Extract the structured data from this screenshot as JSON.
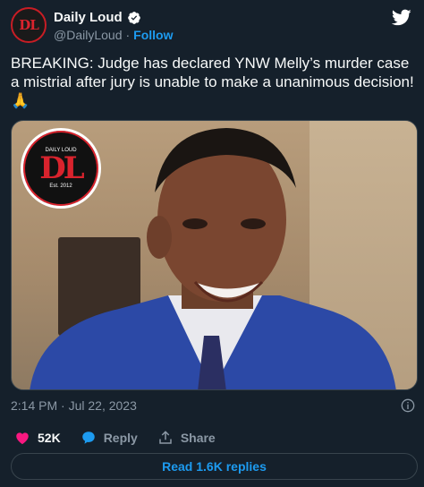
{
  "author": {
    "name": "Daily Loud",
    "handle": "@DailyLoud",
    "separator": "·",
    "follow_label": "Follow",
    "avatar_text": "DL"
  },
  "tweet": {
    "text": "BREAKING: Judge has declared YNW Melly’s murder case a mistrial after jury is unable to make a unanimous decision! 🙏",
    "timestamp": "2:14 PM · Jul 22, 2023"
  },
  "media": {
    "badge_text": "DL",
    "badge_caption": "DAILY LOUD",
    "badge_est": "Est. 2012"
  },
  "actions": {
    "likes": "52K",
    "reply_label": "Reply",
    "share_label": "Share"
  },
  "read_replies_label": "Read 1.6K replies",
  "colors": {
    "background": "#15202b",
    "accent": "#1d9bf0",
    "like": "#f91880",
    "muted": "#8b98a5"
  }
}
